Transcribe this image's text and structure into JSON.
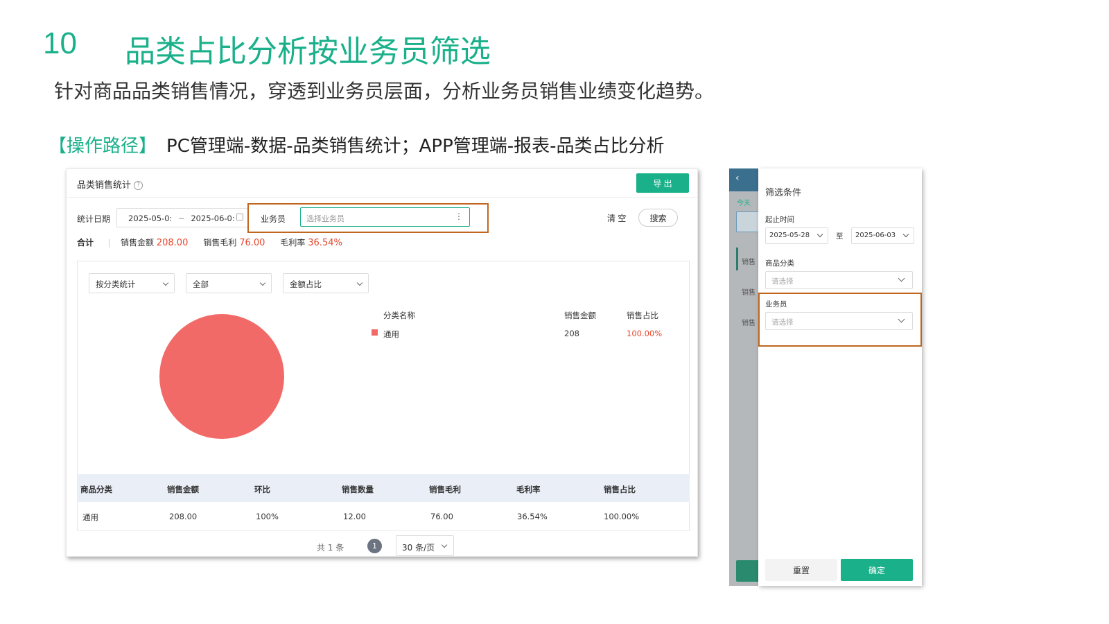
{
  "header": {
    "section_number": "10",
    "title": "品类占比分析按业务员筛选",
    "subtitle": "针对商品品类销售情况，穿透到业务员层面，分析业务员销售业绩变化趋势。",
    "path_tag": "【操作路径】",
    "path_text": "PC管理端-数据-品类销售统计；APP管理端-报表-品类占比分析"
  },
  "pc": {
    "page_title": "品类销售统计",
    "help_icon": "?",
    "export_label": "导 出",
    "date_label": "统计日期",
    "date_start": "2025-05-0:",
    "date_sep": "~",
    "date_end": "2025-06-0:",
    "salesperson_label": "业务员",
    "salesperson_placeholder": "选择业务员",
    "more_icon": "⋮",
    "clear_label": "清 空",
    "search_label": "搜索",
    "summary": {
      "total_label": "合计",
      "sales_amount_label": "销售金额",
      "sales_amount": "208.00",
      "gross_profit_label": "销售毛利",
      "gross_profit": "76.00",
      "margin_label": "毛利率",
      "margin": "36.54%"
    },
    "filters": [
      "按分类统计",
      "全部",
      "金额占比"
    ],
    "legend": {
      "col_name": "分类名称",
      "col_amount": "销售金额",
      "col_share": "销售占比",
      "rows": [
        {
          "name": "通用",
          "amount": "208",
          "share": "100.00%",
          "color": "#f26a68"
        }
      ]
    },
    "chart_data": {
      "type": "pie",
      "categories": [
        "通用"
      ],
      "values": [
        208
      ],
      "colors": [
        "#f26a68"
      ]
    },
    "table": {
      "columns": [
        "商品分类",
        "销售金额",
        "环比",
        "销售数量",
        "销售毛利",
        "毛利率",
        "销售占比"
      ],
      "rows": [
        [
          "通用",
          "208.00",
          "100%",
          "12.00",
          "76.00",
          "36.54%",
          "100.00%"
        ]
      ]
    },
    "pager": {
      "total": "共 1 条",
      "current_page": "1",
      "page_size": "30 条/页"
    }
  },
  "app": {
    "back_icon": "‹",
    "side_today": "今天",
    "side_items": [
      "销售",
      "销售",
      "销售"
    ],
    "drawer_title": "筛选条件",
    "period_label": "起止时间",
    "date_start": "2025-05-28",
    "date_to": "至",
    "date_end": "2025-06-03",
    "category_label": "商品分类",
    "category_placeholder": "请选择",
    "salesperson_label": "业务员",
    "salesperson_placeholder": "请选择",
    "reset_label": "重置",
    "confirm_label": "确定"
  },
  "colors": {
    "accent": "#19b08a",
    "highlight_box": "#c0661e",
    "value_red": "#e8462c",
    "pie_color": "#f26a68"
  }
}
